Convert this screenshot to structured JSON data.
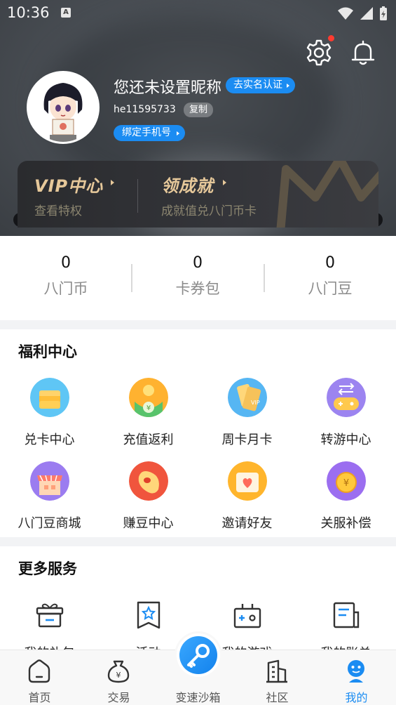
{
  "status_bar": {
    "time": "10:36",
    "notification_letter": "A"
  },
  "header": {
    "nickname": "您还未设置昵称",
    "realname_button": "去实名认证",
    "user_id": "he11595733",
    "copy_button": "复制",
    "bind_phone_button": "绑定手机号"
  },
  "vip_card": {
    "vip_title": "VIP中心",
    "vip_subtitle": "查看特权",
    "achievement_title": "领成就",
    "achievement_subtitle": "成就值兑八门币卡"
  },
  "stats": [
    {
      "value": "0",
      "label": "八门币"
    },
    {
      "value": "0",
      "label": "卡券包"
    },
    {
      "value": "0",
      "label": "八门豆"
    }
  ],
  "welfare": {
    "title": "福利中心",
    "items": [
      {
        "label": "兑卡中心",
        "icon": "card-exchange-icon"
      },
      {
        "label": "充值返利",
        "icon": "recharge-rebate-icon"
      },
      {
        "label": "周卡月卡",
        "icon": "weekly-monthly-card-icon"
      },
      {
        "label": "转游中心",
        "icon": "game-transfer-icon"
      },
      {
        "label": "八门豆商城",
        "icon": "bean-mall-icon"
      },
      {
        "label": "赚豆中心",
        "icon": "earn-beans-icon"
      },
      {
        "label": "邀请好友",
        "icon": "invite-friends-icon"
      },
      {
        "label": "关服补偿",
        "icon": "shutdown-compensation-icon"
      }
    ]
  },
  "more_services": {
    "title": "更多服务",
    "items": [
      {
        "label": "我的礼包",
        "icon": "gift-icon"
      },
      {
        "label": "活动",
        "icon": "activity-icon"
      },
      {
        "label": "我的游戏",
        "icon": "game-console-icon"
      },
      {
        "label": "我的账单",
        "icon": "bill-icon"
      }
    ]
  },
  "tabbar": [
    {
      "label": "首页",
      "icon": "home-icon"
    },
    {
      "label": "交易",
      "icon": "trade-icon"
    },
    {
      "label": "变速沙箱",
      "icon": "speed-sandbox-icon"
    },
    {
      "label": "社区",
      "icon": "community-icon"
    },
    {
      "label": "我的",
      "icon": "profile-icon"
    }
  ],
  "colors": {
    "accent": "#1b8cf2",
    "vip_gold": "#e6c89a"
  }
}
